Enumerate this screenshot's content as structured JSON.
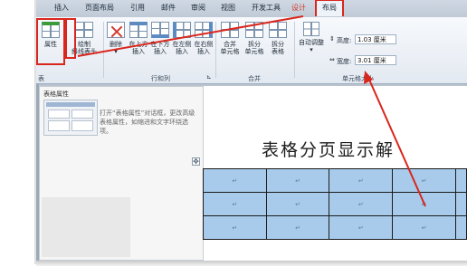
{
  "tabs": [
    {
      "label": "插入"
    },
    {
      "label": "页面布局"
    },
    {
      "label": "引用"
    },
    {
      "label": "邮件"
    },
    {
      "label": "审阅"
    },
    {
      "label": "视图"
    },
    {
      "label": "开发工具"
    },
    {
      "label": "设计"
    },
    {
      "label": "布局"
    }
  ],
  "ribbon": {
    "properties_label": "属性",
    "draw_diagonal_line1": "绘制",
    "draw_diagonal_line2": "斜线表头",
    "delete_label": "删除",
    "delete_caret": "▾",
    "insert_above_line1": "在上方",
    "insert_above_line2": "插入",
    "insert_below_line1": "在下方",
    "insert_below_line2": "插入",
    "insert_left_line1": "在左侧",
    "insert_left_line2": "插入",
    "insert_right_line1": "在右侧",
    "insert_right_line2": "插入",
    "merge_cells_line1": "合并",
    "merge_cells_line2": "单元格",
    "split_cells_line1": "拆分",
    "split_cells_line2": "单元格",
    "split_table_line1": "拆分",
    "split_table_line2": "表格",
    "autofit_label": "自动调整",
    "autofit_caret": "▾",
    "height_label": "高度:",
    "height_value": "1.03 厘米",
    "width_label": "宽度:",
    "width_value": "3.01 厘米",
    "group_table": "表",
    "group_rows_cols": "行和列",
    "group_merge": "合并",
    "group_cell_size": "单元格大小",
    "dialog_launcher": "⊾"
  },
  "tooltip": {
    "title": "表格属性",
    "body": "打开“表格属性”对话框，更改高级表格属性，如缩进和文字环绕选项。"
  },
  "document": {
    "heading": "表格分页显示解",
    "move_handle": "✥",
    "cell_mark": "↵"
  },
  "colors": {
    "highlight": "#d9261c",
    "cell_fill": "#a8cbeb"
  }
}
